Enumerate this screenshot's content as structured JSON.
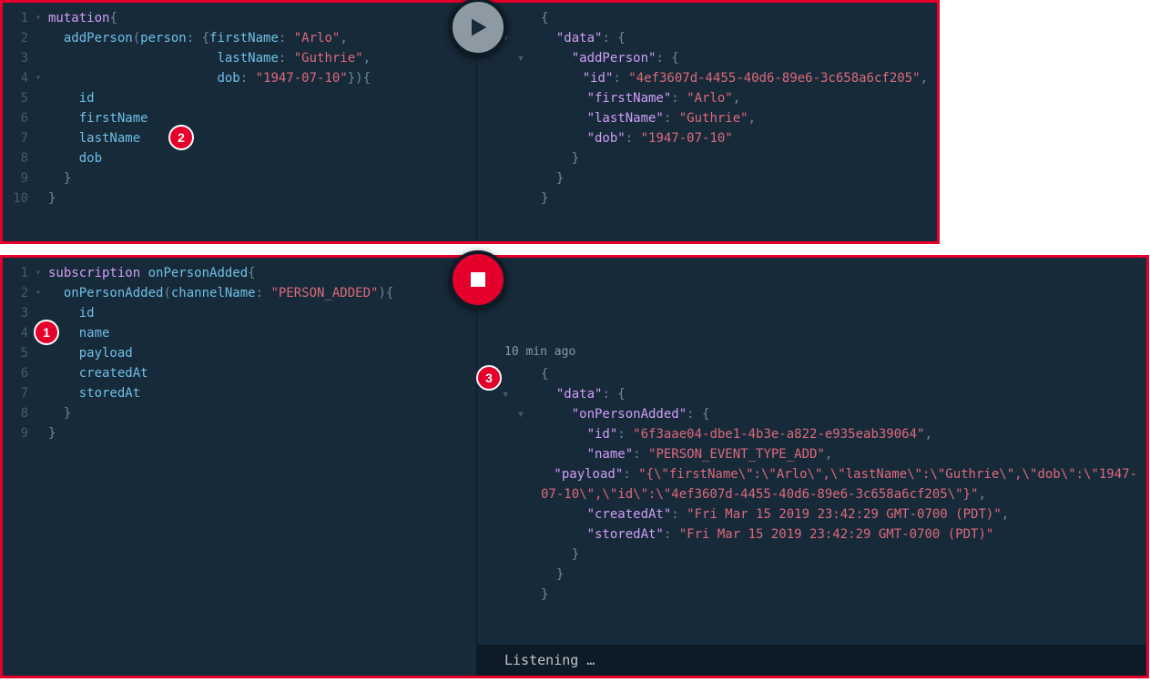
{
  "callouts": {
    "c1": "1",
    "c2": "2",
    "c3": "3"
  },
  "panel1": {
    "query": {
      "lines": [
        {
          "n": "1",
          "fold": "▾",
          "tokens": [
            {
              "t": "mutation",
              "c": "kw"
            },
            {
              "t": "{",
              "c": "punc"
            }
          ]
        },
        {
          "n": "2",
          "fold": "",
          "tokens": [
            {
              "t": "  ",
              "c": ""
            },
            {
              "t": "addPerson",
              "c": "field"
            },
            {
              "t": "(",
              "c": "punc"
            },
            {
              "t": "person",
              "c": "field"
            },
            {
              "t": ": {",
              "c": "punc"
            },
            {
              "t": "firstName",
              "c": "field"
            },
            {
              "t": ": ",
              "c": "punc"
            },
            {
              "t": "\"Arlo\"",
              "c": "str"
            },
            {
              "t": ",",
              "c": "punc"
            }
          ]
        },
        {
          "n": "3",
          "fold": "",
          "tokens": [
            {
              "t": "                      ",
              "c": ""
            },
            {
              "t": "lastName",
              "c": "field"
            },
            {
              "t": ": ",
              "c": "punc"
            },
            {
              "t": "\"Guthrie\"",
              "c": "str"
            },
            {
              "t": ",",
              "c": "punc"
            }
          ]
        },
        {
          "n": "4",
          "fold": "▾",
          "tokens": [
            {
              "t": "                      ",
              "c": ""
            },
            {
              "t": "dob",
              "c": "field"
            },
            {
              "t": ": ",
              "c": "punc"
            },
            {
              "t": "\"1947-07-10\"",
              "c": "str"
            },
            {
              "t": "}){",
              "c": "punc"
            }
          ]
        },
        {
          "n": "5",
          "fold": "",
          "tokens": [
            {
              "t": "    ",
              "c": ""
            },
            {
              "t": "id",
              "c": "field"
            }
          ]
        },
        {
          "n": "6",
          "fold": "",
          "tokens": [
            {
              "t": "    ",
              "c": ""
            },
            {
              "t": "firstName",
              "c": "field"
            }
          ]
        },
        {
          "n": "7",
          "fold": "",
          "tokens": [
            {
              "t": "    ",
              "c": ""
            },
            {
              "t": "lastName",
              "c": "field"
            }
          ]
        },
        {
          "n": "8",
          "fold": "",
          "tokens": [
            {
              "t": "    ",
              "c": ""
            },
            {
              "t": "dob",
              "c": "field"
            }
          ]
        },
        {
          "n": "9",
          "fold": "",
          "tokens": [
            {
              "t": "  }",
              "c": "punc"
            }
          ]
        },
        {
          "n": "10",
          "fold": "",
          "tokens": [
            {
              "t": "}",
              "c": "punc"
            }
          ]
        }
      ]
    },
    "result": [
      {
        "fold": "▾ ",
        "indent": "",
        "tokens": [
          {
            "t": "{",
            "c": "json-punc"
          }
        ]
      },
      {
        "fold": "  ▾ ",
        "indent": "  ",
        "tokens": [
          {
            "t": "\"data\"",
            "c": "json-key"
          },
          {
            "t": ": {",
            "c": "json-punc"
          }
        ]
      },
      {
        "fold": "    ▾ ",
        "indent": "    ",
        "tokens": [
          {
            "t": "\"addPerson\"",
            "c": "json-key"
          },
          {
            "t": ": {",
            "c": "json-punc"
          }
        ]
      },
      {
        "fold": "",
        "indent": "      ",
        "tokens": [
          {
            "t": "\"id\"",
            "c": "json-key"
          },
          {
            "t": ": ",
            "c": "json-punc"
          },
          {
            "t": "\"4ef3607d-4455-40d6-89e6-3c658a6cf205\"",
            "c": "json-str"
          },
          {
            "t": ",",
            "c": "json-punc"
          }
        ]
      },
      {
        "fold": "",
        "indent": "      ",
        "tokens": [
          {
            "t": "\"firstName\"",
            "c": "json-key"
          },
          {
            "t": ": ",
            "c": "json-punc"
          },
          {
            "t": "\"Arlo\"",
            "c": "json-str"
          },
          {
            "t": ",",
            "c": "json-punc"
          }
        ]
      },
      {
        "fold": "",
        "indent": "      ",
        "tokens": [
          {
            "t": "\"lastName\"",
            "c": "json-key"
          },
          {
            "t": ": ",
            "c": "json-punc"
          },
          {
            "t": "\"Guthrie\"",
            "c": "json-str"
          },
          {
            "t": ",",
            "c": "json-punc"
          }
        ]
      },
      {
        "fold": "",
        "indent": "      ",
        "tokens": [
          {
            "t": "\"dob\"",
            "c": "json-key"
          },
          {
            "t": ": ",
            "c": "json-punc"
          },
          {
            "t": "\"1947-07-10\"",
            "c": "json-str"
          }
        ]
      },
      {
        "fold": "",
        "indent": "    ",
        "tokens": [
          {
            "t": "}",
            "c": "json-punc"
          }
        ]
      },
      {
        "fold": "",
        "indent": "  ",
        "tokens": [
          {
            "t": "}",
            "c": "json-punc"
          }
        ]
      },
      {
        "fold": "",
        "indent": "",
        "tokens": [
          {
            "t": "}",
            "c": "json-punc"
          }
        ]
      }
    ]
  },
  "panel2": {
    "query": {
      "lines": [
        {
          "n": "1",
          "fold": "▾",
          "tokens": [
            {
              "t": "subscription",
              "c": "kw"
            },
            {
              "t": " ",
              "c": ""
            },
            {
              "t": "onPersonAdded",
              "c": "field"
            },
            {
              "t": "{",
              "c": "punc"
            }
          ]
        },
        {
          "n": "2",
          "fold": "▾",
          "tokens": [
            {
              "t": "  ",
              "c": ""
            },
            {
              "t": "onPersonAdded",
              "c": "field"
            },
            {
              "t": "(",
              "c": "punc"
            },
            {
              "t": "channelName",
              "c": "field"
            },
            {
              "t": ": ",
              "c": "punc"
            },
            {
              "t": "\"PERSON_ADDED\"",
              "c": "str"
            },
            {
              "t": "){",
              "c": "punc"
            }
          ]
        },
        {
          "n": "3",
          "fold": "",
          "tokens": [
            {
              "t": "    ",
              "c": ""
            },
            {
              "t": "id",
              "c": "field"
            }
          ]
        },
        {
          "n": "4",
          "fold": "",
          "tokens": [
            {
              "t": "    ",
              "c": ""
            },
            {
              "t": "name",
              "c": "field"
            }
          ]
        },
        {
          "n": "5",
          "fold": "",
          "tokens": [
            {
              "t": "    ",
              "c": ""
            },
            {
              "t": "payload",
              "c": "field"
            }
          ]
        },
        {
          "n": "6",
          "fold": "",
          "tokens": [
            {
              "t": "    ",
              "c": ""
            },
            {
              "t": "createdAt",
              "c": "field"
            }
          ]
        },
        {
          "n": "7",
          "fold": "",
          "tokens": [
            {
              "t": "    ",
              "c": ""
            },
            {
              "t": "storedAt",
              "c": "field"
            }
          ]
        },
        {
          "n": "8",
          "fold": "",
          "tokens": [
            {
              "t": "  }",
              "c": "punc"
            }
          ]
        },
        {
          "n": "9",
          "fold": "",
          "tokens": [
            {
              "t": "}",
              "c": "punc"
            }
          ]
        }
      ]
    },
    "timestamp": "10 min ago",
    "result": [
      {
        "fold": "▾ ",
        "indent": "",
        "tokens": [
          {
            "t": "{",
            "c": "json-punc"
          }
        ]
      },
      {
        "fold": "  ▾ ",
        "indent": "  ",
        "tokens": [
          {
            "t": "\"data\"",
            "c": "json-key"
          },
          {
            "t": ": {",
            "c": "json-punc"
          }
        ]
      },
      {
        "fold": "    ▾ ",
        "indent": "    ",
        "tokens": [
          {
            "t": "\"onPersonAdded\"",
            "c": "json-key"
          },
          {
            "t": ": {",
            "c": "json-punc"
          }
        ]
      },
      {
        "fold": "",
        "indent": "      ",
        "tokens": [
          {
            "t": "\"id\"",
            "c": "json-key"
          },
          {
            "t": ": ",
            "c": "json-punc"
          },
          {
            "t": "\"6f3aae04-dbe1-4b3e-a822-e935eab39064\"",
            "c": "json-str"
          },
          {
            "t": ",",
            "c": "json-punc"
          }
        ]
      },
      {
        "fold": "",
        "indent": "      ",
        "tokens": [
          {
            "t": "\"name\"",
            "c": "json-key"
          },
          {
            "t": ": ",
            "c": "json-punc"
          },
          {
            "t": "\"PERSON_EVENT_TYPE_ADD\"",
            "c": "json-str"
          },
          {
            "t": ",",
            "c": "json-punc"
          }
        ]
      },
      {
        "fold": "",
        "indent": "      ",
        "tokens": [
          {
            "t": "\"payload\"",
            "c": "json-key"
          },
          {
            "t": ": ",
            "c": "json-punc"
          },
          {
            "t": "\"{\\\"firstName\\\":\\\"Arlo\\\",\\\"lastName\\\":\\\"Guthrie\\\",\\\"dob\\\":\\\"1947-",
            "c": "json-str"
          }
        ]
      },
      {
        "fold": "",
        "indent": "",
        "tokens": [
          {
            "t": "07-10\\\",\\\"id\\\":\\\"4ef3607d-4455-40d6-89e6-3c658a6cf205\\\"}\"",
            "c": "json-str"
          },
          {
            "t": ",",
            "c": "json-punc"
          }
        ]
      },
      {
        "fold": "",
        "indent": "      ",
        "tokens": [
          {
            "t": "\"createdAt\"",
            "c": "json-key"
          },
          {
            "t": ": ",
            "c": "json-punc"
          },
          {
            "t": "\"Fri Mar 15 2019 23:42:29 GMT-0700 (PDT)\"",
            "c": "json-str"
          },
          {
            "t": ",",
            "c": "json-punc"
          }
        ]
      },
      {
        "fold": "",
        "indent": "      ",
        "tokens": [
          {
            "t": "\"storedAt\"",
            "c": "json-key"
          },
          {
            "t": ": ",
            "c": "json-punc"
          },
          {
            "t": "\"Fri Mar 15 2019 23:42:29 GMT-0700 (PDT)\"",
            "c": "json-str"
          }
        ]
      },
      {
        "fold": "",
        "indent": "    ",
        "tokens": [
          {
            "t": "}",
            "c": "json-punc"
          }
        ]
      },
      {
        "fold": "",
        "indent": "  ",
        "tokens": [
          {
            "t": "}",
            "c": "json-punc"
          }
        ]
      },
      {
        "fold": "",
        "indent": "",
        "tokens": [
          {
            "t": "}",
            "c": "json-punc"
          }
        ]
      }
    ],
    "listening": "Listening …"
  }
}
